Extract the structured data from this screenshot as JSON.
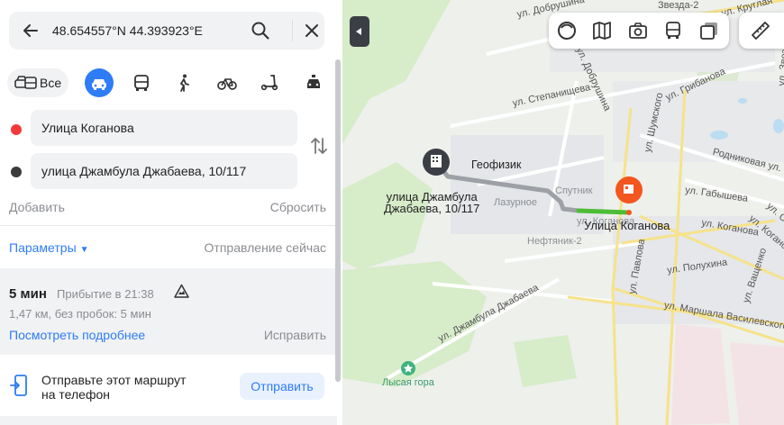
{
  "search": {
    "query": "48.654557°N 44.393923°E"
  },
  "modes": {
    "all_label": "Все"
  },
  "points": {
    "from": "Улица Коганова",
    "to": "улица Джамбула Джабаева, 10/117",
    "from_color": "#f33a3a",
    "to_color": "#3b3b3b"
  },
  "actions": {
    "add": "Добавить",
    "reset": "Сбросить"
  },
  "params": {
    "label": "Параметры",
    "caret": "▼",
    "depart": "Отправление сейчас"
  },
  "route": {
    "duration": "5 мин",
    "arrival": "Прибытие в 21:38",
    "distance": "1,47 км, без пробок: 5 мин",
    "details": "Посмотреть подробнее",
    "fix": "Исправить"
  },
  "send": {
    "line1": "Отправьте этот маршрут",
    "line2": "на телефон",
    "button": "Отправить"
  },
  "map": {
    "streets": [
      "ул. Добрушина",
      "ул. Добрушина",
      "ул. Степанищева",
      "ул. Грибанова",
      "ул. Шумского",
      "Родниковая ул.",
      "ул. Габышева",
      "ул. Коганова",
      "ул. Коганова",
      "ул. Павлова",
      "ул. Полухина",
      "ул. Ващенко",
      "ул. Маршала Василевского",
      "ул. Джамбула Джабаева",
      "ул. Север",
      "Звезда-2",
      "ул. Круглая",
      "ул. Звезд"
    ],
    "places": [
      "Геофизик",
      "Лазурное",
      "Нефтяник-2",
      "Спутник",
      "ул. Коганова",
      "Лысая гора"
    ],
    "start_label_1": "улица Джамбула",
    "start_label_2": "Джабаева, 10/117",
    "end_label": "Улица Коганова",
    "colors": {
      "route": "#9da0a6",
      "route_active": "#4cbd35",
      "finish": "#f3561f",
      "accent": "#2e7cf6"
    }
  }
}
